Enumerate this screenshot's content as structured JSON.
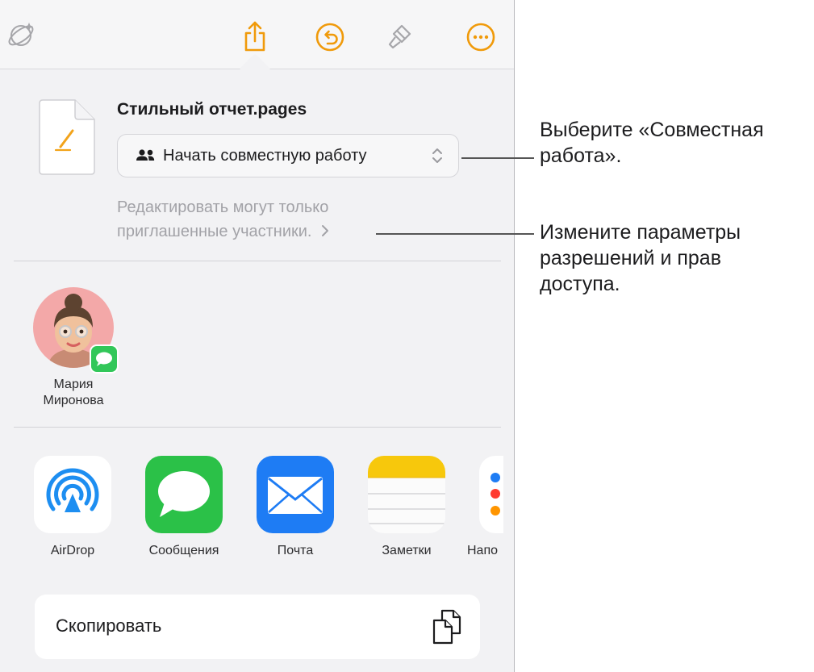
{
  "document": {
    "name": "Стильный отчет.pages",
    "collaboration_option": "Начать совместную работу",
    "permissions_line1": "Редактировать могут только",
    "permissions_line2": "приглашенные участники."
  },
  "contact": {
    "name_line1": "Мария",
    "name_line2": "Миронова"
  },
  "apps": [
    {
      "label": "AirDrop"
    },
    {
      "label": "Сообщения"
    },
    {
      "label": "Почта"
    },
    {
      "label": "Заметки"
    },
    {
      "label": "Напо"
    }
  ],
  "copy_action": {
    "label": "Скопировать"
  },
  "callouts": [
    {
      "text": "Выберите «Совместная\nработа»."
    },
    {
      "text": "Измените параметры\nразрешений и прав\nдоступа."
    }
  ],
  "colors": {
    "accent": "#f09a0a",
    "messages_green": "#32c759",
    "mail_blue": "#1e7cf4",
    "airdrop_blue": "#1d8ef1",
    "notes_yellow": "#f7c80c"
  },
  "icons": [
    "collaboration-icon",
    "share-icon",
    "undo-icon",
    "brush-icon",
    "more-icon",
    "people-icon",
    "chevron-updown-icon",
    "chevron-right-icon",
    "copy-icon"
  ]
}
